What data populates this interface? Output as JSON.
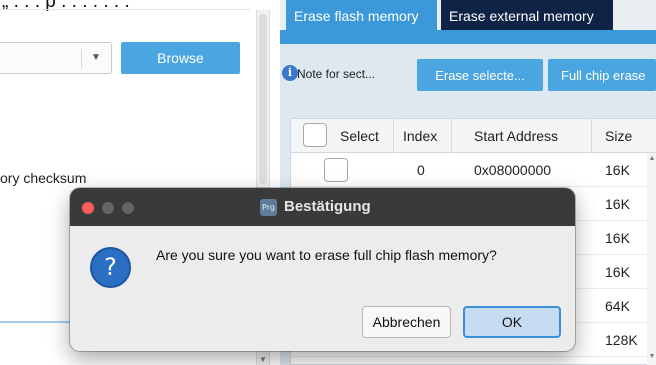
{
  "left_panel": {
    "top_text": "„ . . . p . . . . . . .",
    "browse_label": "Browse",
    "checksum_label": "ory checksum"
  },
  "tabs": [
    {
      "label": "Erase flash memory",
      "active": true
    },
    {
      "label": "Erase external memory",
      "active": false
    }
  ],
  "toolbar": {
    "note_label": "Note for sect...",
    "erase_selected_label": "Erase selecte...",
    "full_chip_erase_label": "Full chip erase",
    "info_icon": "info-icon"
  },
  "table": {
    "headers": [
      "Select",
      "Index",
      "Start Address",
      "Size"
    ],
    "rows": [
      {
        "index": "0",
        "start_address": "0x08000000",
        "size": "16K"
      },
      {
        "index": "",
        "start_address": "",
        "size": "16K"
      },
      {
        "index": "",
        "start_address": "",
        "size": "16K"
      },
      {
        "index": "",
        "start_address": "",
        "size": "16K"
      },
      {
        "index": "",
        "start_address": "",
        "size": "64K"
      },
      {
        "index": "",
        "start_address": "",
        "size": "128K"
      }
    ]
  },
  "dialog": {
    "title": "Bestätigung",
    "app_icon_text": "Prg",
    "message": "Are you sure you want to erase full chip flash memory?",
    "cancel_label": "Abbrechen",
    "ok_label": "OK",
    "icon": "question-icon"
  },
  "colors": {
    "accent": "#3b99d9",
    "button": "#4aa6e0",
    "inactive_tab": "#0e2346",
    "titlebar": "#3a3a3a",
    "ok_border": "#3d8fd8"
  }
}
